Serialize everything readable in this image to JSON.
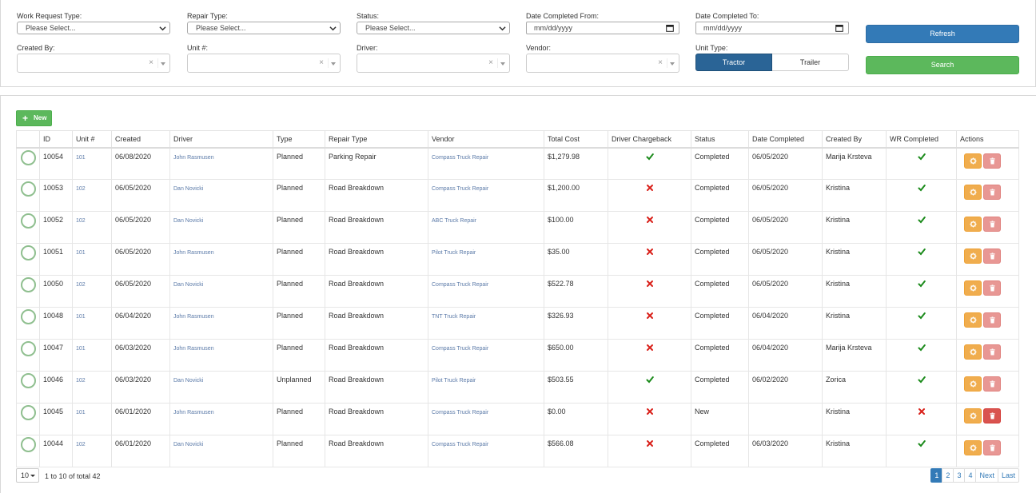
{
  "filters": {
    "work_request_type": {
      "label": "Work Request Type:",
      "value": "Please Select..."
    },
    "repair_type": {
      "label": "Repair Type:",
      "value": "Please Select..."
    },
    "status": {
      "label": "Status:",
      "value": "Please Select..."
    },
    "date_from": {
      "label": "Date Completed From:",
      "value": "mm/dd/yyyy"
    },
    "date_to": {
      "label": "Date Completed To:",
      "value": "mm/dd/yyyy"
    },
    "created_by": {
      "label": "Created By:",
      "clear": "×"
    },
    "unit": {
      "label": "Unit #:",
      "clear": "×"
    },
    "driver": {
      "label": "Driver:",
      "clear": "×"
    },
    "vendor": {
      "label": "Vendor:",
      "clear": "×"
    },
    "unit_type": {
      "label": "Unit Type:",
      "options": [
        "Tractor",
        "Trailer"
      ],
      "selected": "Tractor"
    }
  },
  "buttons": {
    "refresh": "Refresh",
    "search": "Search",
    "new": "New"
  },
  "colors": {
    "primary": "#337ab7",
    "success": "#5cb85c",
    "warning": "#f0ad4e",
    "danger": "#d9534f",
    "check": "#1a8a1a",
    "cross": "#d9201a"
  },
  "table": {
    "columns": [
      "",
      "ID",
      "Unit #",
      "Created",
      "Driver",
      "Type",
      "Repair Type",
      "Vendor",
      "Total Cost",
      "Driver Chargeback",
      "Status",
      "Date Completed",
      "Created By",
      "WR Completed",
      "Actions"
    ],
    "rows": [
      {
        "id": "10054",
        "unit": "101",
        "created": "06/08/2020",
        "driver": "John Rasmusen",
        "type": "Planned",
        "repair_type": "Parking Repair",
        "vendor": "Compass Truck Repair",
        "cost": "$1,279.98",
        "chargeback": true,
        "status": "Completed",
        "date_completed": "06/05/2020",
        "created_by": "Marija Krsteva",
        "wr_completed": true
      },
      {
        "id": "10053",
        "unit": "102",
        "created": "06/05/2020",
        "driver": "Dan Novicki",
        "type": "Planned",
        "repair_type": "Road Breakdown",
        "vendor": "Compass Truck Repair",
        "cost": "$1,200.00",
        "chargeback": false,
        "status": "Completed",
        "date_completed": "06/05/2020",
        "created_by": "Kristina",
        "wr_completed": true
      },
      {
        "id": "10052",
        "unit": "102",
        "created": "06/05/2020",
        "driver": "Dan Novicki",
        "type": "Planned",
        "repair_type": "Road Breakdown",
        "vendor": "ABC Truck Repair",
        "cost": "$100.00",
        "chargeback": false,
        "status": "Completed",
        "date_completed": "06/05/2020",
        "created_by": "Kristina",
        "wr_completed": true
      },
      {
        "id": "10051",
        "unit": "101",
        "created": "06/05/2020",
        "driver": "John Rasmusen",
        "type": "Planned",
        "repair_type": "Road Breakdown",
        "vendor": "Pilot Truck Repair",
        "cost": "$35.00",
        "chargeback": false,
        "status": "Completed",
        "date_completed": "06/05/2020",
        "created_by": "Kristina",
        "wr_completed": true
      },
      {
        "id": "10050",
        "unit": "102",
        "created": "06/05/2020",
        "driver": "Dan Novicki",
        "type": "Planned",
        "repair_type": "Road Breakdown",
        "vendor": "Compass Truck Repair",
        "cost": "$522.78",
        "chargeback": false,
        "status": "Completed",
        "date_completed": "06/05/2020",
        "created_by": "Kristina",
        "wr_completed": true
      },
      {
        "id": "10048",
        "unit": "101",
        "created": "06/04/2020",
        "driver": "John Rasmusen",
        "type": "Planned",
        "repair_type": "Road Breakdown",
        "vendor": "TNT Truck Repair",
        "cost": "$326.93",
        "chargeback": false,
        "status": "Completed",
        "date_completed": "06/04/2020",
        "created_by": "Kristina",
        "wr_completed": true
      },
      {
        "id": "10047",
        "unit": "101",
        "created": "06/03/2020",
        "driver": "John Rasmusen",
        "type": "Planned",
        "repair_type": "Road Breakdown",
        "vendor": "Compass Truck Repair",
        "cost": "$650.00",
        "chargeback": false,
        "status": "Completed",
        "date_completed": "06/04/2020",
        "created_by": "Marija Krsteva",
        "wr_completed": true
      },
      {
        "id": "10046",
        "unit": "102",
        "created": "06/03/2020",
        "driver": "Dan Novicki",
        "type": "Unplanned",
        "repair_type": "Road Breakdown",
        "vendor": "Pilot Truck Repair",
        "cost": "$503.55",
        "chargeback": true,
        "status": "Completed",
        "date_completed": "06/02/2020",
        "created_by": "Zorica",
        "wr_completed": true
      },
      {
        "id": "10045",
        "unit": "101",
        "created": "06/01/2020",
        "driver": "John Rasmusen",
        "type": "Planned",
        "repair_type": "Road Breakdown",
        "vendor": "Compass Truck Repair",
        "cost": "$0.00",
        "chargeback": false,
        "status": "New",
        "date_completed": "",
        "created_by": "Kristina",
        "wr_completed": false
      },
      {
        "id": "10044",
        "unit": "102",
        "created": "06/01/2020",
        "driver": "Dan Novicki",
        "type": "Planned",
        "repair_type": "Road Breakdown",
        "vendor": "Compass Truck Repair",
        "cost": "$566.08",
        "chargeback": false,
        "status": "Completed",
        "date_completed": "06/03/2020",
        "created_by": "Kristina",
        "wr_completed": true
      }
    ]
  },
  "pagination": {
    "page_size": "10",
    "info": "1 to 10 of total 42",
    "pages": [
      "1",
      "2",
      "3",
      "4"
    ],
    "current_page": "1",
    "next": "Next",
    "last": "Last"
  }
}
